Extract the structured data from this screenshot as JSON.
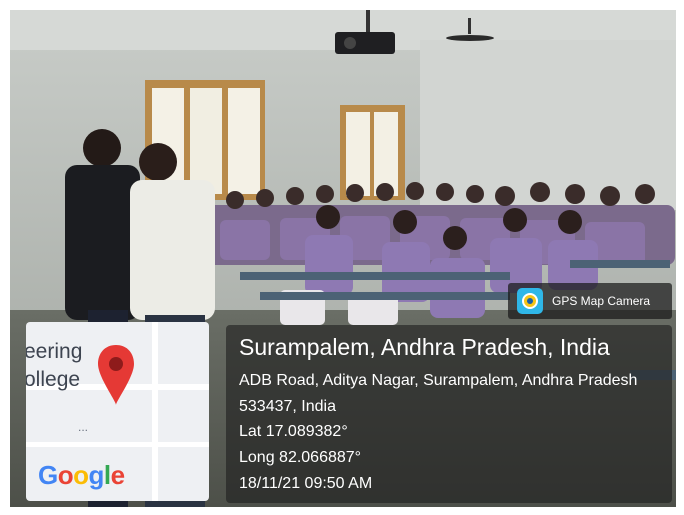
{
  "badge": {
    "app_name": "GPS Map Camera",
    "icon": "gps-map-camera-icon"
  },
  "location": {
    "title": "Surampalem, Andhra Pradesh, India",
    "address": "ADB Road, Aditya Nagar, Surampalem, Andhra Pradesh 533437, India",
    "lat": "Lat 17.089382°",
    "long": "Long 82.066887°",
    "timestamp": "18/11/21 09:50 AM"
  },
  "map": {
    "label_line1": "eering",
    "label_line2": "ollege",
    "dots": "...",
    "provider": "Google",
    "pin_icon": "map-pin-icon",
    "pin_color": "#e53935"
  },
  "colors": {
    "overlay_bg": "#1e1e1e",
    "text": "#ffffff"
  }
}
